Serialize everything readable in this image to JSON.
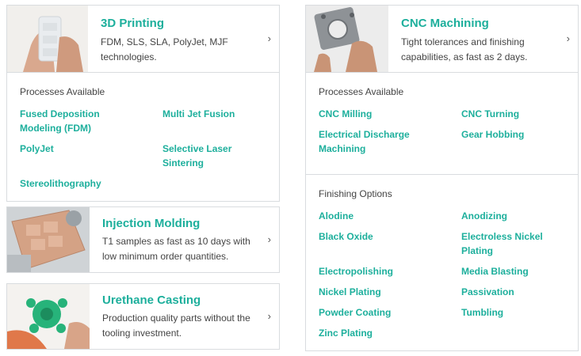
{
  "cards": {
    "printing": {
      "title": "3D Printing",
      "description": "FDM, SLS, SLA, PolyJet, MJF technologies.",
      "processes_label": "Processes Available",
      "processes": [
        "Fused Deposition Modeling (FDM)",
        "Multi Jet Fusion",
        "PolyJet",
        "Selective Laser Sintering",
        "Stereolithography"
      ]
    },
    "injection": {
      "title": "Injection Molding",
      "description": "T1 samples as fast as 10 days with low minimum order quantities."
    },
    "urethane": {
      "title": "Urethane Casting",
      "description": "Production quality parts without the tooling investment."
    },
    "cnc": {
      "title": "CNC Machining",
      "description": "Tight tolerances and finishing capabilities, as fast as 2 days.",
      "processes_label": "Processes Available",
      "processes": [
        "CNC Milling",
        "CNC Turning",
        "Electrical Discharge Machining",
        "Gear Hobbing"
      ],
      "finishing_label": "Finishing Options",
      "finishing": [
        "Alodine",
        "Anodizing",
        "Black Oxide",
        "Electroless Nickel Plating",
        "Electropolishing",
        "Media Blasting",
        "Nickel Plating",
        "Passivation",
        "Powder Coating",
        "Tumbling",
        "Zinc Plating"
      ]
    }
  },
  "chevron": "›",
  "colors": {
    "accent": "#1daf9c",
    "border": "#d9dcdf",
    "text": "#444444"
  }
}
